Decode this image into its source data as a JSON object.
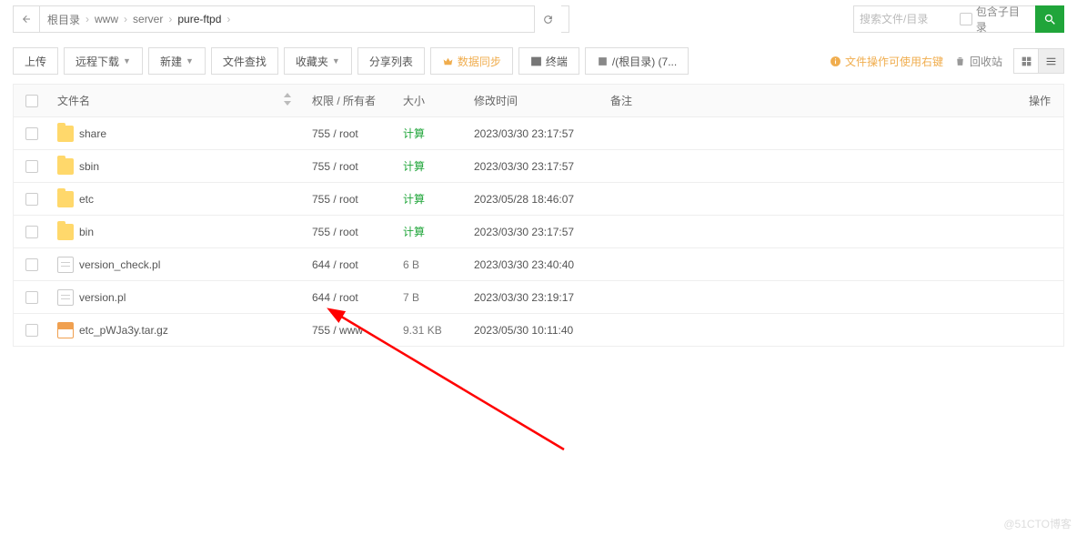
{
  "breadcrumb": {
    "back_title": "返回",
    "items": [
      "根目录",
      "www",
      "server",
      "pure-ftpd"
    ],
    "refresh_title": "刷新"
  },
  "search": {
    "placeholder": "搜索文件/目录",
    "include_sub_label": "包含子目录"
  },
  "toolbar": {
    "upload": "上传",
    "remote_dl": "远程下载",
    "new": "新建",
    "find": "文件查找",
    "fav": "收藏夹",
    "share": "分享列表",
    "sync": "数据同步",
    "terminal": "终端",
    "path_btn": "/(根目录) (7...",
    "hint": "文件操作可使用右键",
    "recycle": "回收站"
  },
  "columns": {
    "name": "文件名",
    "perm": "权限 / 所有者",
    "size": "大小",
    "mtime": "修改时间",
    "note": "备注",
    "ops": "操作"
  },
  "rows": [
    {
      "icon": "folder",
      "name": "share",
      "perm": "755 / root",
      "size": "计算",
      "size_kind": "calc",
      "mtime": "2023/03/30 23:17:57"
    },
    {
      "icon": "folder",
      "name": "sbin",
      "perm": "755 / root",
      "size": "计算",
      "size_kind": "calc",
      "mtime": "2023/03/30 23:17:57"
    },
    {
      "icon": "folder",
      "name": "etc",
      "perm": "755 / root",
      "size": "计算",
      "size_kind": "calc",
      "mtime": "2023/05/28 18:46:07"
    },
    {
      "icon": "folder",
      "name": "bin",
      "perm": "755 / root",
      "size": "计算",
      "size_kind": "calc",
      "mtime": "2023/03/30 23:17:57"
    },
    {
      "icon": "file",
      "name": "version_check.pl",
      "perm": "644 / root",
      "size": "6 B",
      "size_kind": "val",
      "mtime": "2023/03/30 23:40:40"
    },
    {
      "icon": "file",
      "name": "version.pl",
      "perm": "644 / root",
      "size": "7 B",
      "size_kind": "val",
      "mtime": "2023/03/30 23:19:17"
    },
    {
      "icon": "tar",
      "name": "etc_pWJa3y.tar.gz",
      "perm": "755 / www",
      "size": "9.31 KB",
      "size_kind": "val",
      "mtime": "2023/05/30 10:11:40"
    }
  ],
  "watermark": "@51CTO博客"
}
